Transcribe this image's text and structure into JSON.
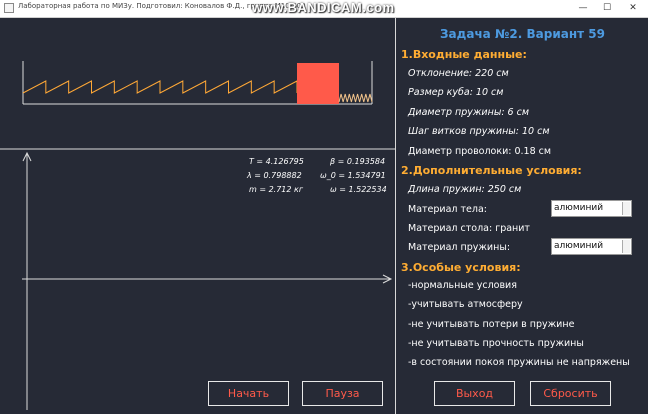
{
  "window": {
    "title": "Лабораторная работа по МИЗу. Подготовил: Коновалов Ф.Д., группа М10-303",
    "watermark": "www.BANDICAM.com",
    "minimize": "—",
    "maximize": "☐",
    "close": "✕"
  },
  "readouts": {
    "T": "T = 4.126795",
    "beta": "β = 0.193584",
    "lambda": "λ = 0.798882",
    "omega0": "ω_0 = 1.534791",
    "m": "m = 2.712 кг",
    "omega": "ω = 1.522534"
  },
  "buttons": {
    "start": "Начать",
    "pause": "Пауза",
    "exit": "Выход",
    "reset": "Сбросить"
  },
  "panel": {
    "title": "Задача №2. Вариант 59",
    "input_header": "1.Входные данные:",
    "input": [
      "Отклонение: 220 см",
      "Размер куба: 10 см",
      "Диаметр пружины: 6 см",
      "Шаг витков пружины: 10 см",
      "Диаметр проволоки: 0.18 см"
    ],
    "extra_header": "2.Дополнительные условия:",
    "spring_length": "Длина пружин: 250 см",
    "body_material_label": "Материал тела:",
    "body_material_value": "алюминий",
    "table_material": "Материал стола: гранит",
    "spring_material_label": "Материал пружины:",
    "spring_material_value": "алюминий",
    "special_header": "3.Особые условия:",
    "special": [
      "-нормальные условия",
      "-учитывать атмосферу",
      "-не учитывать потери в пружине",
      "-не учитывать прочность пружины",
      "-в состоянии покоя пружины не напряжены"
    ]
  },
  "colors": {
    "background": "#262a36",
    "spring_left": "#ffa836",
    "spring_right": "#f0c28a",
    "cube": "#ff5a4a",
    "accent_title": "#4d9ae0",
    "accent_section": "#ffad33",
    "button_text": "#ff5a4a"
  }
}
